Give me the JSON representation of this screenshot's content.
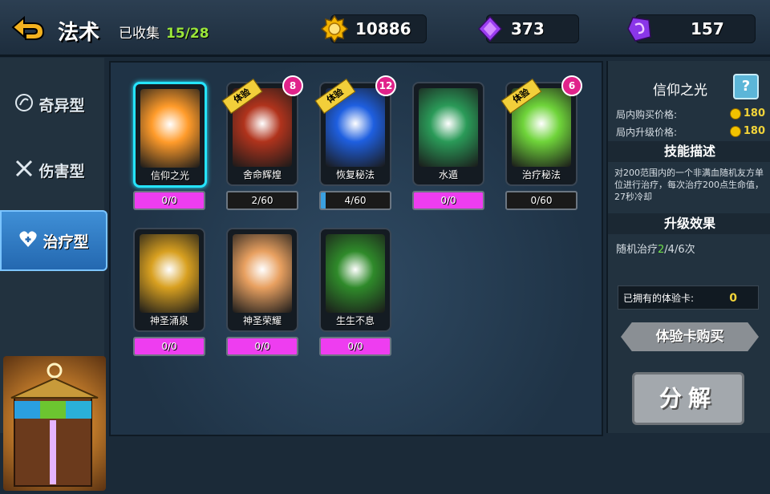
{
  "header": {
    "title": "法术",
    "collected_label": "已收集",
    "collected_count": "15/28",
    "gold": "10886",
    "crystal": "373",
    "gem": "157"
  },
  "sidebar": {
    "tabs": [
      {
        "label": "奇异型",
        "icon": "swirl-icon"
      },
      {
        "label": "伤害型",
        "icon": "crossed-swords-icon"
      },
      {
        "label": "治疗型",
        "icon": "heart-icon"
      }
    ],
    "active_tab": "治疗型"
  },
  "cards": [
    {
      "name": "信仰之光",
      "progress": "0/0",
      "trial": false,
      "badge": "",
      "selected": true,
      "fill": 1.0,
      "color": "#ff9b2a"
    },
    {
      "name": "舍命辉煌",
      "progress": "2/60",
      "trial": true,
      "trial_label": "体验",
      "badge": "8",
      "selected": false,
      "fill": 0.0,
      "color": "#b0331c"
    },
    {
      "name": "恢复秘法",
      "progress": "4/60",
      "trial": true,
      "trial_label": "体验",
      "badge": "12",
      "selected": false,
      "fill": 0.07,
      "color": "#1e5fe0"
    },
    {
      "name": "水遁",
      "progress": "0/0",
      "trial": false,
      "badge": "",
      "selected": false,
      "fill": 1.0,
      "color": "#2a9a58"
    },
    {
      "name": "治疗秘法",
      "progress": "0/60",
      "trial": true,
      "trial_label": "体验",
      "badge": "6",
      "selected": false,
      "fill": 0.0,
      "color": "#6fd43a"
    },
    {
      "name": "神圣涌泉",
      "progress": "0/0",
      "trial": false,
      "badge": "",
      "selected": false,
      "fill": 1.0,
      "color": "#d8a020"
    },
    {
      "name": "神圣荣耀",
      "progress": "0/0",
      "trial": false,
      "badge": "",
      "selected": false,
      "fill": 1.0,
      "color": "#e8a060"
    },
    {
      "name": "生生不息",
      "progress": "0/0",
      "trial": false,
      "badge": "",
      "selected": false,
      "fill": 1.0,
      "color": "#2f8a2a"
    }
  ],
  "panel": {
    "skill_name": "信仰之光",
    "help_label": "?",
    "buy_price_label": "局内购买价格:",
    "buy_price": "180",
    "upgrade_price_label": "局内升级价格:",
    "upgrade_price": "180",
    "desc_title": "技能描述",
    "description": "对200范围内的一个非满血随机友方单位进行治疗，每次治疗200点生命值，27秒冷却",
    "upgrade_title": "升级效果",
    "upgrade_prefix": "随机治疗",
    "upgrade_highlight": "2",
    "upgrade_suffix": "/4/6次",
    "owned_label": "已拥有的体验卡:",
    "owned_count": "0",
    "buy_button": "体验卡购买",
    "decompose_button": "分解"
  },
  "colors": {
    "accent_cyan": "#25e4ff",
    "progress_pink": "#ee3df0",
    "active_tab_blue": "#2468b0",
    "gold": "#f2d43a"
  }
}
